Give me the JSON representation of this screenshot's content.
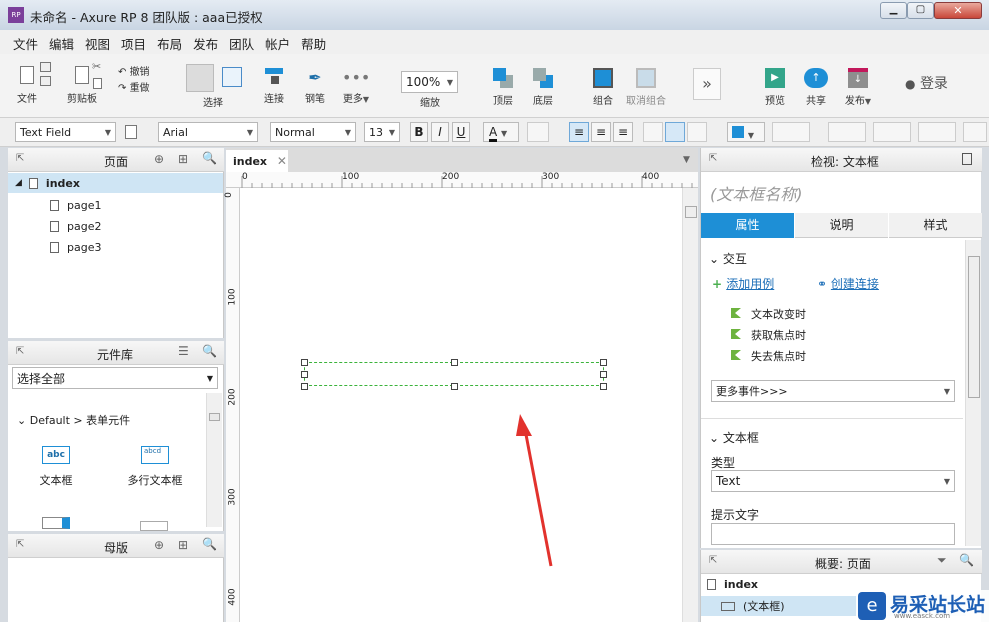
{
  "window": {
    "title": "未命名 - Axure RP 8 团队版 : aaa已授权",
    "app_badge": "RP"
  },
  "menu": [
    "文件",
    "编辑",
    "视图",
    "项目",
    "布局",
    "发布",
    "团队",
    "帐户",
    "帮助"
  ],
  "toolbar": {
    "file": "文件",
    "clipboard": "剪贴板",
    "undo": "撤销",
    "redo": "重做",
    "select": "选择",
    "connect": "连接",
    "pen": "钢笔",
    "more": "更多",
    "zoom_value": "100%",
    "zoom": "缩放",
    "top": "顶层",
    "bottom": "底层",
    "group": "组合",
    "ungroup": "取消组合",
    "preview": "预览",
    "share": "共享",
    "publish": "发布",
    "login": "登录"
  },
  "format": {
    "widget_type": "Text Field",
    "font": "Arial",
    "style": "Normal",
    "size": "13",
    "bold": "B",
    "italic": "I",
    "underline": "U",
    "text_color_letter": "A",
    "fill_color": "#1e8fd6"
  },
  "pages_panel": {
    "title": "页面",
    "items": [
      {
        "label": "index"
      },
      {
        "label": "page1"
      },
      {
        "label": "page2"
      },
      {
        "label": "page3"
      }
    ]
  },
  "library_panel": {
    "title": "元件库",
    "selector": "选择全部",
    "group": "Default > 表单元件",
    "widgets": [
      "文本框",
      "多行文本框"
    ],
    "text_field_preview": "abc",
    "multiline_preview": "abcd"
  },
  "master_panel": {
    "title": "母版"
  },
  "canvas": {
    "tab": "index",
    "hruler": [
      "0",
      "100",
      "200",
      "300",
      "400"
    ],
    "vruler": [
      "0",
      "100",
      "200",
      "300",
      "400"
    ]
  },
  "inspector": {
    "title": "检视: 文本框",
    "name_placeholder": "(文本框名称)",
    "tabs": [
      "属性",
      "说明",
      "样式"
    ],
    "interaction": "交互",
    "add_case": "添加用例",
    "create_link": "创建连接",
    "events": [
      "文本改变时",
      "获取焦点时",
      "失去焦点时"
    ],
    "more_events": "更多事件>>>",
    "textbox_section": "文本框",
    "type_label": "类型",
    "type_value": "Text",
    "hint_label": "提示文字"
  },
  "outline": {
    "title": "概要: 页面",
    "page": "index",
    "item": "(文本框)"
  },
  "watermark": {
    "cn": "易采站长站",
    "en": "www.easck.com"
  }
}
